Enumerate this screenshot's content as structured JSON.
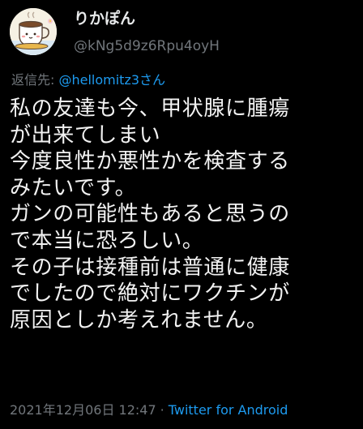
{
  "author": {
    "display_name": "りかぽん",
    "handle": "@kNg5d9z6Rpu4oyH",
    "avatar_icon": "coffee-cup-mascot-avatar",
    "avatar_caption": "おつかれ"
  },
  "reply": {
    "prefix": "返信先: ",
    "mention": "@hellomitz3さん"
  },
  "body_lines": [
    "私の友達も今、甲状腺に腫瘍",
    "が出来てしまい",
    "今度良性か悪性かを検査する",
    "みたいです。",
    "ガンの可能性もあると思うの",
    "で本当に恐ろしい。",
    "その子は接種前は普通に健康",
    "でしたので絶対にワクチンが",
    "原因としか考えれません。"
  ],
  "meta": {
    "timestamp": "2021年12月06日 12:47",
    "separator": "·",
    "source": "Twitter for Android"
  },
  "colors": {
    "background": "#000000",
    "text": "#e7e9ea",
    "secondary": "#71767b",
    "link": "#1d9bf0"
  }
}
